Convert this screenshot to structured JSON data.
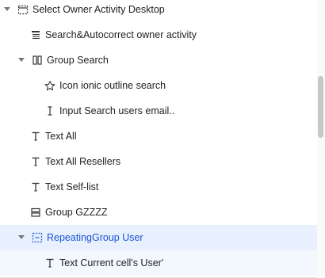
{
  "tree": {
    "items": [
      {
        "label": "Select Owner Activity Desktop",
        "icon": "popup-dashed-icon",
        "expanded": true
      },
      {
        "label": "Search&Autocorrect owner activity",
        "icon": "list-element-icon"
      },
      {
        "label": "Group Search",
        "icon": "column-group-icon",
        "expanded": true
      },
      {
        "label": "Icon ionic outline search",
        "icon": "star-outline-icon"
      },
      {
        "label": "Input Search users email..",
        "icon": "text-cursor-icon"
      },
      {
        "label": "Text All",
        "icon": "text-t-icon"
      },
      {
        "label": "Text All Resellers",
        "icon": "text-t-icon"
      },
      {
        "label": "Text Self-list",
        "icon": "text-t-icon"
      },
      {
        "label": "Group GZZZZ",
        "icon": "row-group-icon"
      },
      {
        "label": "RepeatingGroup User",
        "icon": "repeating-group-icon",
        "expanded": true,
        "selected": true
      },
      {
        "label": "Text Current cell's User'",
        "icon": "text-t-icon"
      }
    ]
  },
  "colors": {
    "selected_bg": "#e8f0fe",
    "selected_text": "#1a56d6",
    "hover_bg": "#f3f8fe"
  }
}
